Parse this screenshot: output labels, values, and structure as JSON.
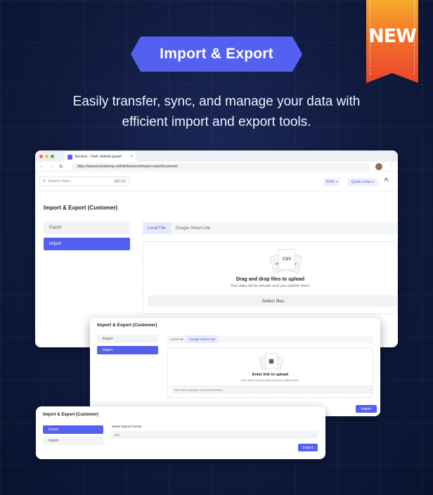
{
  "hero": {
    "pill_label": "Import & Export",
    "ribbon": "NEW",
    "tagline_line1": "Easily transfer, sync, and manage your data with",
    "tagline_line2": "efficient import and export tools."
  },
  "browser": {
    "tab_title": "Service - Fish: Admin panel",
    "url": "https://laravel.pixelstrap.net/fish/backend/import-export/customer",
    "search_placeholder": "Search Here...",
    "search_shortcut": "Ctrl + K",
    "pos_label": "POS +",
    "quick_links_label": "Quick Links +"
  },
  "screen1": {
    "title": "Import & Export (Customer)",
    "side": [
      "Export",
      "Import"
    ],
    "tabs": [
      "Local File",
      "Google Sheet Link"
    ],
    "file_label": "CSV",
    "drop_title": "Drag and drop files to upload",
    "drop_sub": "Your data will be private until you publish them.",
    "select_files": "Select files"
  },
  "screen2": {
    "title": "Import & Export (Customer)",
    "side": [
      "Export",
      "Import"
    ],
    "tabs": [
      "Local File",
      "Google Sheet Link"
    ],
    "drop_title": "Enter link to upload",
    "drop_sub": "Your data will be private until you publish them.",
    "link_placeholder": "https://docs.google.com/spreadsheets/",
    "import_button": "Import"
  },
  "screen3": {
    "title": "Import & Export (Customer)",
    "side": [
      "Export",
      "Import"
    ],
    "format_label": "Select Export Format",
    "format_value": "csv",
    "export_button": "Export"
  },
  "colors": {
    "accent": "#5460f0",
    "background": "#0f1a3d",
    "ribbon": "#f16a2a"
  }
}
